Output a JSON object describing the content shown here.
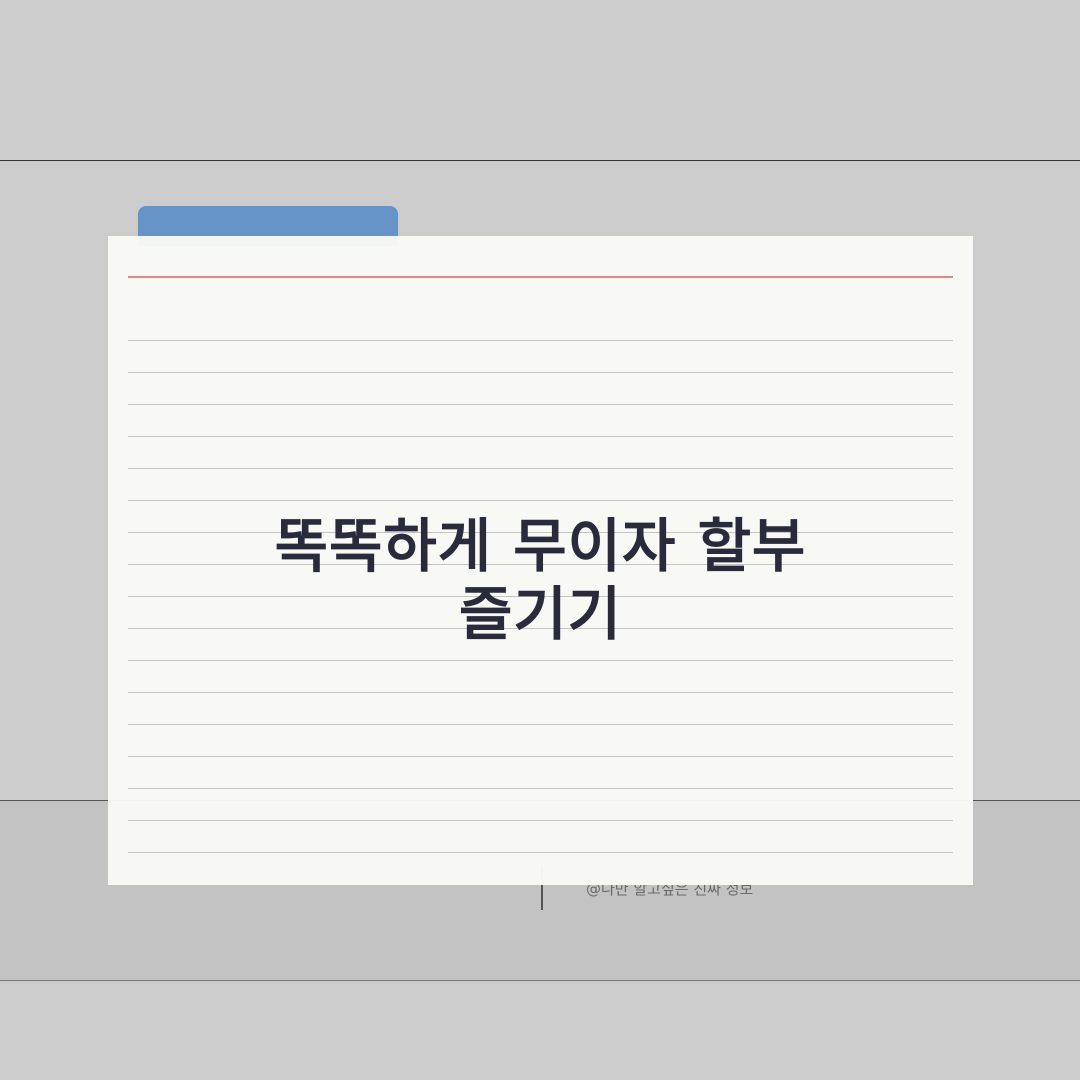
{
  "card": {
    "title_line1": "똑똑하게 무이자 할부",
    "title_line2": "즐기기"
  },
  "footer": {
    "text": "@나만 알고싶은 진짜 정보"
  },
  "colors": {
    "background": "#cccccc",
    "tab": "#6694c9",
    "card": "#f9f9f5",
    "red_rule": "#dd8a85",
    "title": "#2a2a3d"
  }
}
